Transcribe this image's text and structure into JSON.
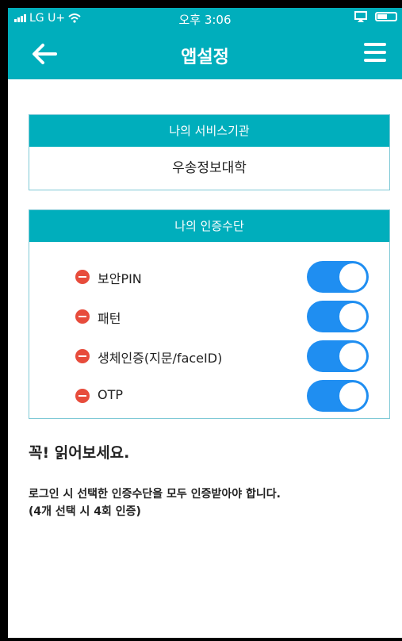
{
  "status_bar": {
    "carrier": "LG U+",
    "time": "오후 3:06"
  },
  "header": {
    "title": "앱설정"
  },
  "service_panel": {
    "title": "나의 서비스기관",
    "value": "우송정보대학"
  },
  "auth_panel": {
    "title": "나의 인증수단",
    "items": [
      {
        "label": "보안PIN",
        "enabled": true
      },
      {
        "label": "패턴",
        "enabled": true
      },
      {
        "label": "생체인증(지문/faceID)",
        "enabled": true
      },
      {
        "label": "OTP",
        "enabled": true
      }
    ]
  },
  "notice": {
    "title": "꼭! 읽어보세요.",
    "line1": "로그인 시 선택한 인증수단을 모두 인증받아야 합니다.",
    "line2": "(4개 선택 시 4회 인증)"
  },
  "colors": {
    "brand": "#00aebc",
    "toggle_on": "#1f8ef1",
    "remove": "#e74c3c"
  }
}
